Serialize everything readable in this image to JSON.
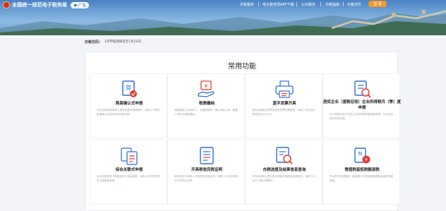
{
  "header": {
    "title": "全国统一规范电子税务局",
    "region": "广东",
    "nav": [
      "评看税务",
      "电子税务局APP下载",
      "公众服务",
      "办税指南",
      "办税日历"
    ],
    "login_label": "登 录"
  },
  "subbar": {
    "label": "办税日历:",
    "text": "1月申报期限延至1月20日"
  },
  "main": {
    "section_title": "常用功能",
    "tiles": [
      {
        "name": "简易确认式申报",
        "desc": "对业务简单的纳税人提供税费申报等服务，纳税人只需对数据确认后即可完成申报申报。",
        "icon": "simple-declaration-icon"
      },
      {
        "name": "税费缴纳",
        "desc": "税费缴款业务纳税人，可缴纳税费，通过申报入库，缴费人员即可直接缴纳。",
        "icon": "tax-payment-icon"
      },
      {
        "name": "蓝字发票开具",
        "desc": "提供全国数电发票及纸质发票开具服务，纳税人可在线开具发票后交付对方。",
        "icon": "blue-invoice-icon"
      },
      {
        "name": "居民企业（查账征收）企业所得税月（季）度申报",
        "desc": "实行查账征收方式的企业所得税季度预缴申报，可在线填报并完成申报。",
        "icon": "enterprise-income-tax-icon"
      },
      {
        "name": "综合关联式申报",
        "desc": "可对关联的多个税费种进行集成申报，纳税人可同时完成多个税费种申报。",
        "icon": "comprehensive-declaration-icon"
      },
      {
        "name": "开具税收完税证明",
        "desc": "税务机关为纳税人开具税收完税证明，纳税人可在线申请并打印对应证明。",
        "icon": "tax-certificate-icon"
      },
      {
        "name": "办税进度及结果信息查询",
        "desc": "可查询纳税人提交的办税事项进度及结果信息，纳税人可及时了解办理情况。",
        "icon": "progress-query-icon"
      },
      {
        "name": "增值税留抵税额退税",
        "desc": "符合条件的增值税一般纳税人可申请增值税期末留抵税额退税。",
        "icon": "vat-refund-icon"
      }
    ]
  },
  "colors": {
    "primary_blue": "#1f5fb8",
    "accent_orange": "#f39a2b",
    "icon_red": "#e23b33",
    "icon_blue": "#2f6fd0"
  }
}
